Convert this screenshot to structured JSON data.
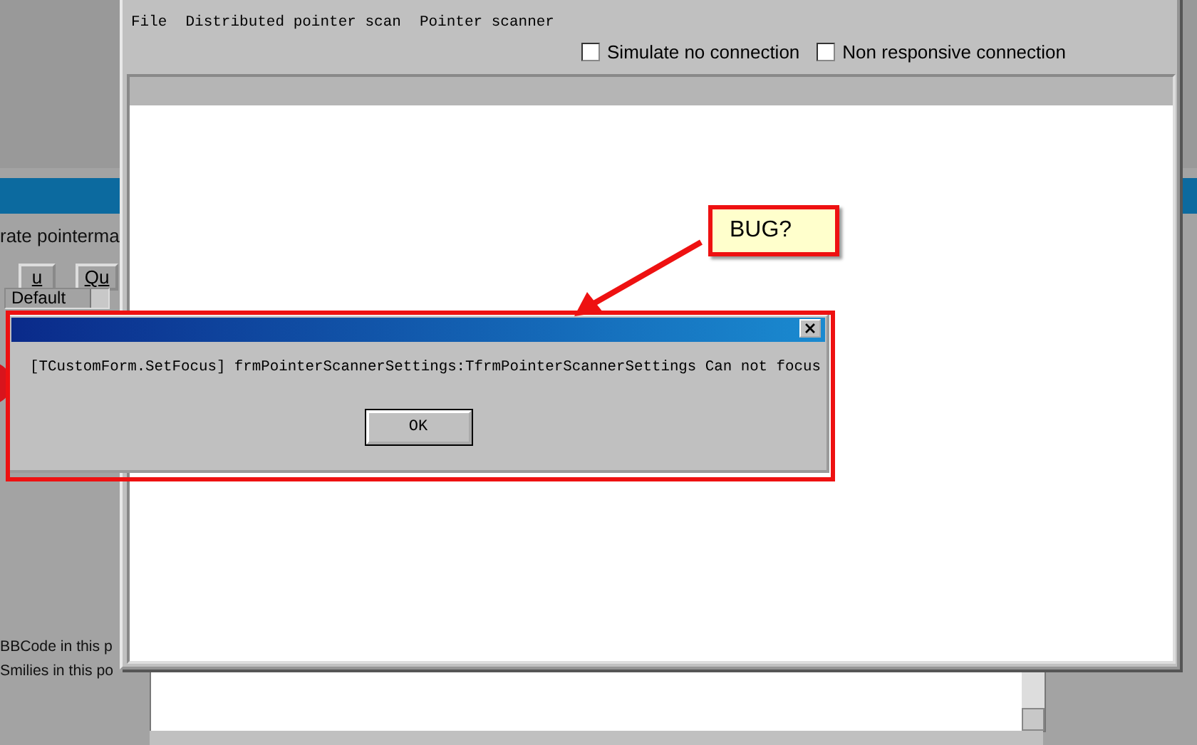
{
  "back_window": {
    "heading": "rate pointerma",
    "buttons": [
      {
        "label": "u"
      },
      {
        "label": "Qu"
      }
    ],
    "dropdown": {
      "value": "Default"
    },
    "options": [
      "BBCode in this p",
      "Smilies in this po"
    ]
  },
  "main_window": {
    "menu": [
      "File",
      "Distributed pointer scan",
      "Pointer scanner"
    ],
    "checkboxes": [
      {
        "label": "Simulate no connection",
        "checked": false
      },
      {
        "label": "Non responsive connection",
        "checked": false
      }
    ]
  },
  "dialog": {
    "message": "[TCustomForm.SetFocus] frmPointerScannerSettings:TfrmPointerScannerSettings Can not focus",
    "button": "OK"
  },
  "annotation": {
    "callout": "BUG?"
  }
}
